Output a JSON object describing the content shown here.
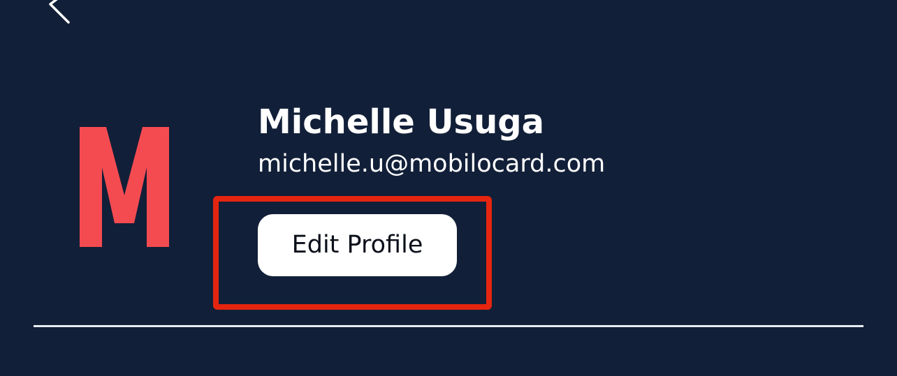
{
  "profile": {
    "avatar_letter": "M",
    "name": "Michelle Usuga",
    "email": "michelle.u@mobilocard.com",
    "edit_button_label": "Edit Profile"
  },
  "colors": {
    "background": "#121f38",
    "avatar": "#f44b51",
    "highlight": "#e5250f",
    "button_bg": "#ffffff",
    "text": "#ffffff"
  },
  "icons": {
    "back": "chevron-left-icon"
  }
}
